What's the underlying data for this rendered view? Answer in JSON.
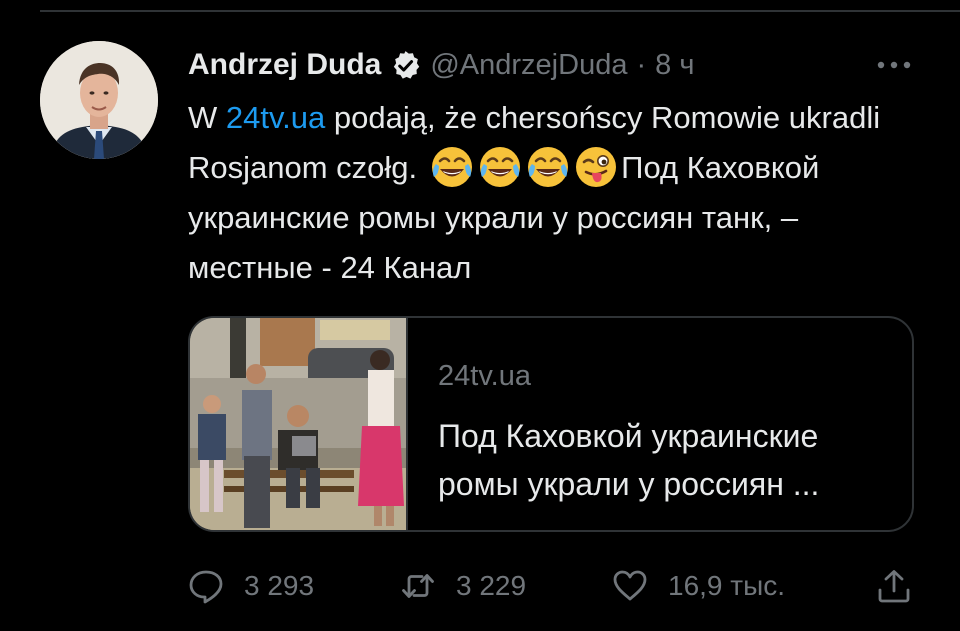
{
  "tweet": {
    "author_name": "Andrzej Duda",
    "handle": "@AndrzejDuda",
    "separator": "·",
    "time_ago": "8 ч",
    "text_prefix": "W ",
    "text_link": "24tv.ua",
    "text_part1": " podają, że chersońscy Romowie ukradli Rosjanom czołg.",
    "emojis": [
      "face-with-tears-of-joy",
      "face-with-tears-of-joy",
      "face-with-tears-of-joy",
      "winking-face-with-tongue"
    ],
    "text_part2": "Под Каховкой украинские ромы украли у россиян танк, – местные - 24 Канал"
  },
  "card": {
    "domain": "24tv.ua",
    "title": "Под Каховкой украинские ромы украли у россиян ..."
  },
  "actions": {
    "replies": "3 293",
    "retweets": "3 229",
    "likes": "16,9 тыс."
  },
  "colors": {
    "background": "#000000",
    "primary_text": "#e7e9ea",
    "secondary_text": "#71767b",
    "link": "#1d9bf0",
    "border": "#2f3336"
  }
}
